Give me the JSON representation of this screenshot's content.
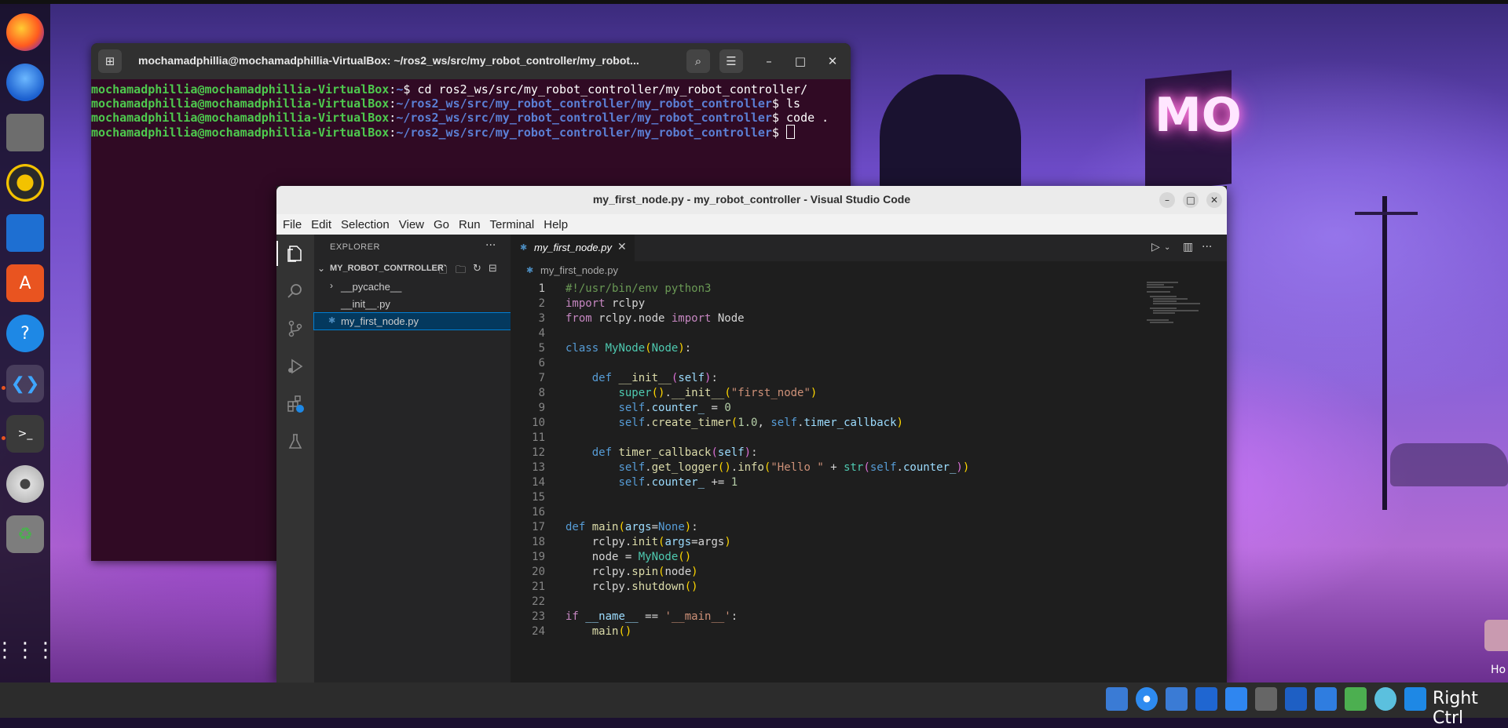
{
  "terminal": {
    "title": "mochamadphillia@mochamadphillia-VirtualBox: ~/ros2_ws/src/my_robot_controller/my_robot...",
    "lines": [
      {
        "user": "mochamadphillia@mochamadphillia-VirtualBox",
        "sep": ":",
        "path": "~",
        "cmd": "$ cd ros2_ws/src/my_robot_controller/my_robot_controller/"
      },
      {
        "user": "mochamadphillia@mochamadphillia-VirtualBox",
        "sep": ":",
        "path": "~/ros2_ws/src/my_robot_controller/my_robot_controller",
        "cmd": "$ ls"
      },
      {
        "user": "mochamadphillia@mochamadphillia-VirtualBox",
        "sep": ":",
        "path": "~/ros2_ws/src/my_robot_controller/my_robot_controller",
        "cmd": "$ code ."
      },
      {
        "user": "mochamadphillia@mochamadphillia-VirtualBox",
        "sep": ":",
        "path": "~/ros2_ws/src/my_robot_controller/my_robot_controller",
        "cmd": "$ "
      }
    ]
  },
  "vscode": {
    "title": "my_first_node.py - my_robot_controller - Visual Studio Code",
    "menu": [
      "File",
      "Edit",
      "Selection",
      "View",
      "Go",
      "Run",
      "Terminal",
      "Help"
    ],
    "explorer_label": "EXPLORER",
    "folder_name": "MY_ROBOT_CONTROLLER",
    "files": [
      "__pycache__",
      "__init__.py",
      "my_first_node.py"
    ],
    "tab_label": "my_first_node.py",
    "breadcrumb": "my_first_node.py",
    "current_line": 1
  },
  "desktop": {
    "sign_text": "MO",
    "home_label": "Ho",
    "right_ctrl": "Right Ctrl"
  },
  "colors": {
    "terminal_bg": "#300a24",
    "prompt_user": "#4ec94e",
    "prompt_path": "#5b7fd4",
    "editor_bg": "#1e1e1e",
    "selection": "#04395e"
  }
}
